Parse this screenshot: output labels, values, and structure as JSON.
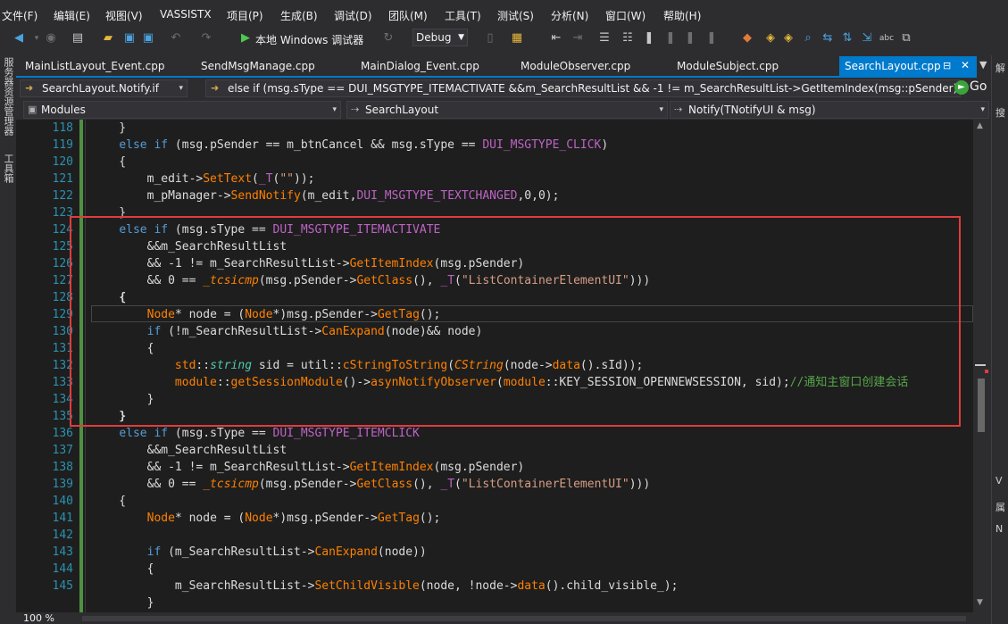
{
  "menu": [
    "文件(F)",
    "编辑(E)",
    "视图(V)",
    "VASSISTX",
    "项目(P)",
    "生成(B)",
    "调试(D)",
    "团队(M)",
    "工具(T)",
    "测试(S)",
    "分析(N)",
    "窗口(W)",
    "帮助(H)"
  ],
  "toolbar": {
    "run_label": "本地 Windows 调试器",
    "config": "Debug"
  },
  "left_rail": [
    "服务器资源管理器",
    "工具箱"
  ],
  "tabs": [
    "MainListLayout_Event.cpp",
    "SendMsgManage.cpp",
    "MainDialog_Event.cpp",
    "ModuleObserver.cpp",
    "ModuleSubject.cpp"
  ],
  "active_tab": "SearchLayout.cpp",
  "navbar": {
    "symbol": "SearchLayout.Notify.if",
    "context": "else if (msg.sType == DUI_MSGTYPE_ITEMACTIVATE &&m_SearchResultList && -1 != m_SearchResultList->GetItemIndex(msg::pSender)",
    "go": "Go",
    "project": "Modules",
    "class": "SearchLayout",
    "method": "Notify(TNotifyUI & msg)"
  },
  "editor": {
    "line_numbers": [
      "118",
      "119",
      "120",
      "121",
      "122",
      "123",
      "124",
      "125",
      "126",
      "127",
      "128",
      "129",
      "130",
      "131",
      "132",
      "133",
      "134",
      "135",
      "136",
      "137",
      "138",
      "139",
      "140",
      "141",
      "142",
      "143",
      "144",
      "145"
    ]
  },
  "status": {
    "zoom": "100 %"
  },
  "right_panel": [
    "解",
    "搜",
    "V",
    "属",
    "N"
  ],
  "colors": {
    "accent": "#007acc",
    "highlight_box": "#e03c3c",
    "keyword": "#569cd6",
    "function": "#ff8000",
    "macro": "#bd63c5",
    "comment": "#57a64a",
    "line_number": "#2b91af"
  },
  "icons": [
    "back-icon",
    "forward-icon",
    "new-project-icon",
    "open-folder-icon",
    "save-icon",
    "save-all-icon",
    "undo-icon",
    "redo-icon",
    "start-icon",
    "refresh-icon",
    "bookmark-icon",
    "breakpoint-icon",
    "go-icon"
  ]
}
